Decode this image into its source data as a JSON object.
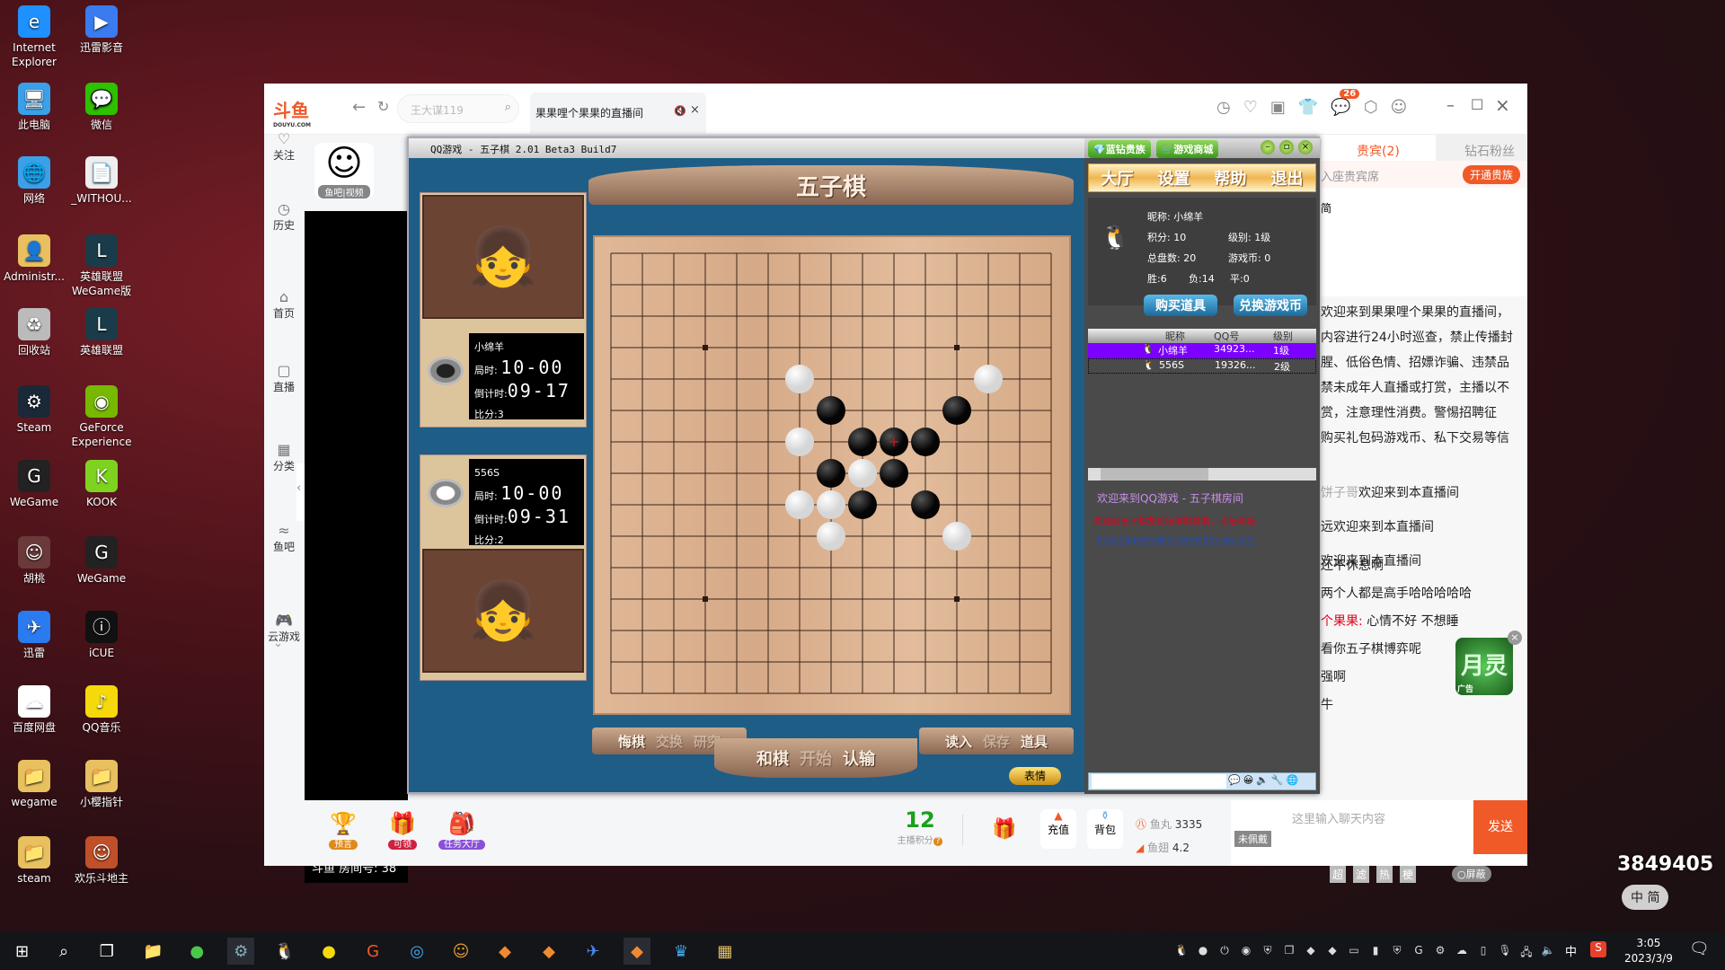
{
  "desktop": {
    "icons": [
      {
        "label": "Internet Explorer",
        "icon": "ie-icon",
        "color": "#1e90ff",
        "glyph": "e"
      },
      {
        "label": "迅雷影音",
        "icon": "xunlei-player-icon",
        "color": "#3a7bef",
        "glyph": "▶"
      },
      {
        "label": "此电脑",
        "icon": "computer-icon",
        "color": "#3aa0e8",
        "glyph": "🖥"
      },
      {
        "label": "微信",
        "icon": "wechat-icon",
        "color": "#2dc100",
        "glyph": "💬"
      },
      {
        "label": "网络",
        "icon": "network-icon",
        "color": "#3aa0e8",
        "glyph": "🌐"
      },
      {
        "label": "_WITHOU...",
        "icon": "file-icon",
        "color": "#eeeeee",
        "glyph": "📄"
      },
      {
        "label": "Administr...",
        "icon": "user-folder-icon",
        "color": "#e8c060",
        "glyph": "👤"
      },
      {
        "label": "英雄联盟WeGame版",
        "icon": "lol-icon",
        "color": "#1a3c4a",
        "glyph": "L"
      },
      {
        "label": "回收站",
        "icon": "recycle-bin-icon",
        "color": "#bbbbbb",
        "glyph": "♻"
      },
      {
        "label": "英雄联盟",
        "icon": "lol-icon",
        "color": "#1a3c4a",
        "glyph": "L"
      },
      {
        "label": "Steam",
        "icon": "steam-icon",
        "color": "#1b2838",
        "glyph": "⚙"
      },
      {
        "label": "GeForce Experience",
        "icon": "geforce-icon",
        "color": "#76b900",
        "glyph": "◉"
      },
      {
        "label": "WeGame",
        "icon": "wegame-icon",
        "color": "#222222",
        "glyph": "G"
      },
      {
        "label": "KOOK",
        "icon": "kook-icon",
        "color": "#7ed321",
        "glyph": "K"
      },
      {
        "label": "胡桃",
        "icon": "hutao-icon",
        "color": "#6a3a3a",
        "glyph": "☺"
      },
      {
        "label": "WeGame",
        "icon": "wegame-icon",
        "color": "#222222",
        "glyph": "G"
      },
      {
        "label": "迅雷",
        "icon": "xunlei-icon",
        "color": "#2a7bef",
        "glyph": "✈"
      },
      {
        "label": "iCUE",
        "icon": "icue-icon",
        "color": "#111111",
        "glyph": "ⓘ"
      },
      {
        "label": "百度网盘",
        "icon": "baidu-pan-icon",
        "color": "#ffffff",
        "glyph": "☁"
      },
      {
        "label": "QQ音乐",
        "icon": "qq-music-icon",
        "color": "#f5d90a",
        "glyph": "♪"
      },
      {
        "label": "wegame",
        "icon": "folder-icon",
        "color": "#e8c060",
        "glyph": "📁"
      },
      {
        "label": "小樱指针",
        "icon": "folder-icon",
        "color": "#e8c060",
        "glyph": "📁"
      },
      {
        "label": "steam",
        "icon": "folder-icon",
        "color": "#e8c060",
        "glyph": "📁"
      },
      {
        "label": "欢乐斗地主",
        "icon": "doudizhu-icon",
        "color": "#c0502a",
        "glyph": "☺"
      }
    ]
  },
  "browser": {
    "logo": "斗鱼",
    "logo_sub": "DOUYU.COM",
    "search_placeholder": "王大谋119",
    "tab_title": "果果哩个果果的直播间",
    "notification_count": "26",
    "nav": [
      "关注",
      "历史",
      "首页",
      "直播",
      "分类",
      "鱼吧",
      "云游戏"
    ],
    "anchor_badge": "鱼吧|视频",
    "room_label": "斗鱼 房间号: 38"
  },
  "game": {
    "window_title": "QQ游戏 - 五子棋    2.01 Beta3 Build7",
    "banner": "五子棋",
    "players": [
      {
        "name": "小绵羊",
        "game_time_label": "局时:",
        "game_time": "10-00",
        "countdown_label": "倒计时:",
        "countdown": "09-17",
        "score": "比分:3",
        "stone": "black"
      },
      {
        "name": "556S",
        "game_time_label": "局时:",
        "game_time": "10-00",
        "countdown_label": "倒计时:",
        "countdown": "09-31",
        "score": "比分:2",
        "stone": "white"
      }
    ],
    "board_size": 15,
    "star_points": [
      [
        3,
        3
      ],
      [
        3,
        11
      ],
      [
        11,
        3
      ],
      [
        11,
        11
      ]
    ],
    "black_stones": [
      [
        7,
        5
      ],
      [
        11,
        5
      ],
      [
        8,
        6
      ],
      [
        9,
        6
      ],
      [
        10,
        6
      ],
      [
        7,
        7
      ],
      [
        9,
        7
      ],
      [
        8,
        8
      ],
      [
        10,
        8
      ]
    ],
    "white_stones": [
      [
        6,
        4
      ],
      [
        12,
        4
      ],
      [
        6,
        6
      ],
      [
        8,
        7
      ],
      [
        6,
        8
      ],
      [
        7,
        8
      ],
      [
        7,
        9
      ],
      [
        11,
        9
      ]
    ],
    "last_move": [
      9,
      6
    ],
    "controls_left": [
      "悔棋",
      "交换",
      "研究"
    ],
    "controls_mid": [
      "和棋",
      "开始",
      "认输"
    ],
    "controls_right": [
      "读入",
      "保存",
      "道具"
    ],
    "disabled": [
      "交换",
      "研究",
      "开始",
      "保存"
    ],
    "emote_button": "表情",
    "top_buttons": [
      "蓝钻贵族",
      "游戏商城"
    ],
    "menu": [
      "大厅",
      "设置",
      "帮助",
      "退出"
    ],
    "profile": {
      "nickname": "昵称: 小绵羊",
      "points": "积分: 10",
      "level": "级别: 1级",
      "total": "总盘数:  20",
      "coins": "游戏币:  0",
      "wins": "胜:6",
      "losses": "负:14",
      "draws": "平:0"
    },
    "buy_button": "购买道具",
    "exchange_button": "兑换游戏币",
    "player_list": {
      "headers": [
        "昵称",
        "QQ号",
        "级别"
      ],
      "rows": [
        [
          "小绵羊",
          "34923...",
          "1级"
        ],
        [
          "556S",
          "19326...",
          "2级"
        ]
      ]
    },
    "room_chat": {
      "welcome": "欢迎来到QQ游戏 - 五子棋房间",
      "forum": "欢迎到五子棋友论坛聊聊看看，论坛地址：",
      "link": "http://qgameqilei.gamebbs.qq.com"
    }
  },
  "chat": {
    "tabs": [
      "贵宾(2)",
      "钻石粉丝"
    ],
    "vip_hint": "入座贵宾席",
    "vip_button": "开通贵族",
    "intro": "简",
    "notice": [
      "欢迎来到果果哩个果果的直播间，",
      "内容进行24小时巡查，禁止传播封",
      "腥、低俗色情、招嫖诈骗、违禁品",
      "禁未成年人直播或打赏，主播以不",
      "赏，注意理性消费。警惕招聘征",
      "购买礼包码游戏币、私下交易等信"
    ],
    "messages": [
      {
        "prefix": "饼子哥",
        "text": "欢迎来到本直播间"
      },
      {
        "text": "远欢迎来到本直播间"
      },
      {
        "text": "欢迎来到本直播间"
      },
      {
        "text": "还不休息啊"
      },
      {
        "text": "两个人都是高手哈哈哈哈哈"
      },
      {
        "user": "个果果:",
        "text": " 心情不好 不想睡"
      },
      {
        "text": "看你五子棋博弈呢"
      },
      {
        "text": "强啊"
      },
      {
        "text": "牛"
      }
    ],
    "ad_label": "广告",
    "filters": [
      "超",
      "滤",
      "热",
      "梗"
    ],
    "block_toggle": "屏蔽",
    "input_placeholder": "这里输入聊天内容",
    "send": "发送",
    "badge": "未佩戴"
  },
  "bottom": {
    "items": [
      "预言",
      "可领",
      "任务大厅"
    ],
    "anchor_score": "12",
    "anchor_score_label": "主播积分",
    "recharge": "充值",
    "backpack": "背包",
    "fishball_label": "鱼丸",
    "fishball": "3335",
    "fin_label": "鱼翅",
    "fin": "4.2"
  },
  "overlay": {
    "room_id": "3849405",
    "ime": "中",
    "ime2": "简"
  },
  "taskbar": {
    "time": "3:05",
    "date": "2023/3/9",
    "ime": "中"
  },
  "colors": {
    "douyu_orange": "#f05a28",
    "selected_row": "#7b00ff",
    "board": "#dcb08c"
  }
}
